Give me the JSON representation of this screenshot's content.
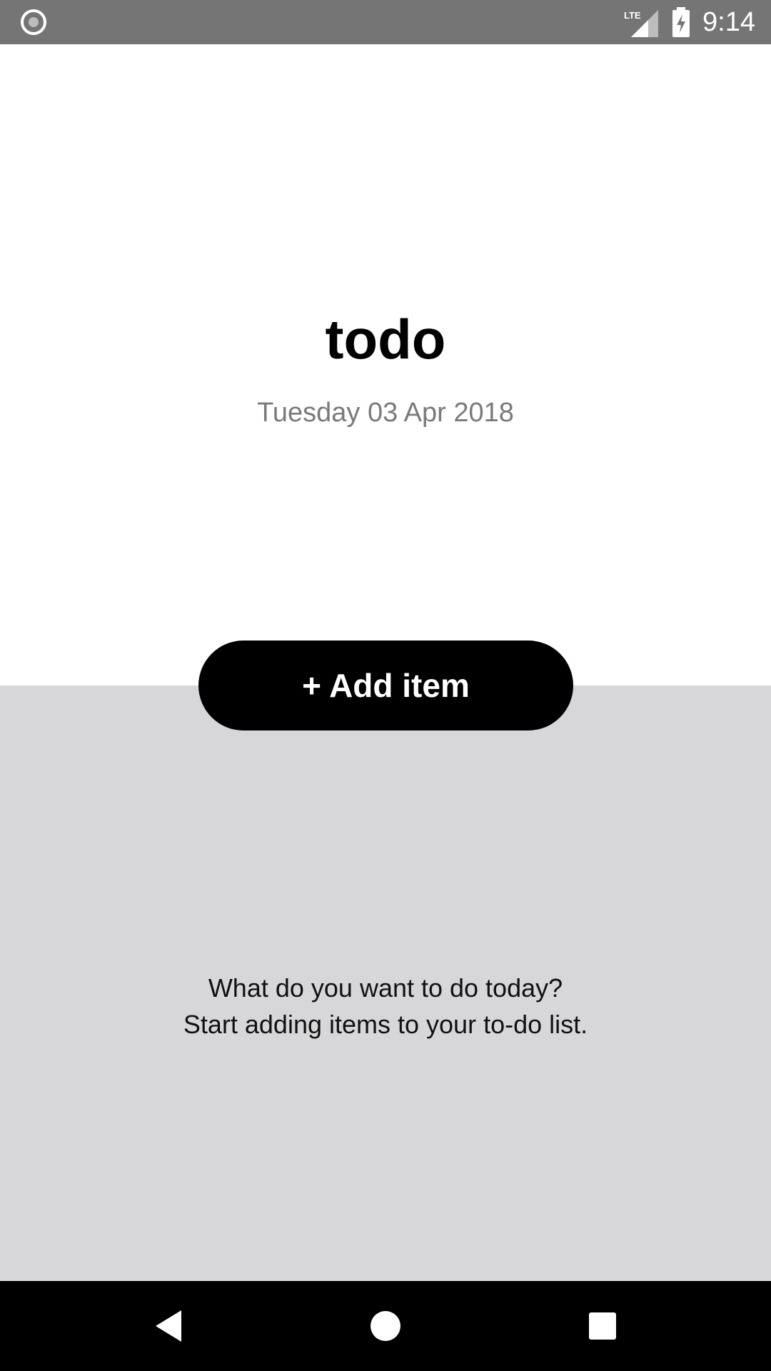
{
  "status_bar": {
    "time": "9:14",
    "network_label": "LTE",
    "icons": [
      "record-icon",
      "lte-signal-icon",
      "battery-charging-icon"
    ]
  },
  "header": {
    "title": "todo",
    "date": "Tuesday 03 Apr 2018"
  },
  "add_button": {
    "label": "+ Add item"
  },
  "empty_state": {
    "line1": "What do you want to do today?",
    "line2": "Start adding items to your to-do list."
  },
  "nav_bar": {
    "icons": [
      "back-icon",
      "home-icon",
      "recents-icon"
    ]
  },
  "colors": {
    "status_bar": "#757575",
    "background_top": "#ffffff",
    "background_bottom": "#d7d7d9",
    "button": "#000000",
    "button_text": "#ffffff",
    "date_text": "#7a7a7a",
    "nav_bar": "#000000"
  }
}
